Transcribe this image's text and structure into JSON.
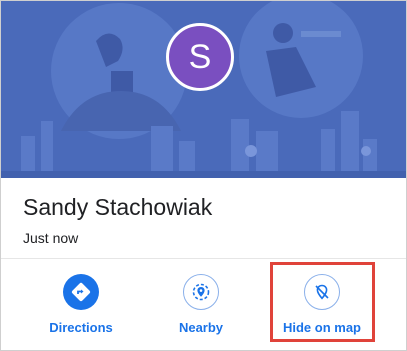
{
  "profile": {
    "avatar_initial": "S",
    "name": "Sandy Stachowiak",
    "last_seen": "Just now"
  },
  "actions": [
    {
      "label": "Directions",
      "icon": "directions-icon"
    },
    {
      "label": "Nearby",
      "icon": "nearby-icon"
    },
    {
      "label": "Hide on map",
      "icon": "hide-on-map-icon"
    }
  ],
  "colors": {
    "banner": "#4a6aba",
    "avatar": "#7a4fc0",
    "accent": "#1a73e8",
    "highlight": "#e0433a"
  }
}
